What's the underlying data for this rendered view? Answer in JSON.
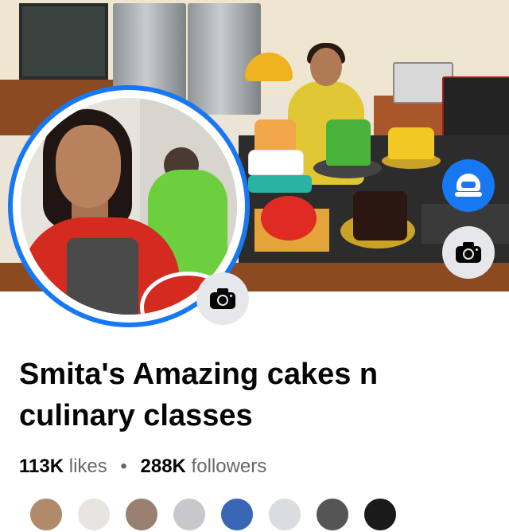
{
  "page": {
    "name": "Smita's Amazing cakes n culinary classes",
    "likes_count": "113K",
    "likes_label": "likes",
    "separator": "•",
    "followers_count": "288K",
    "followers_label": "followers"
  },
  "colors": {
    "accent": "#1877f2",
    "text_primary": "#050505",
    "text_secondary": "#65676b",
    "icon_button_bg": "#e6e7ea"
  },
  "icons": {
    "profile_photo_camera": "camera-icon",
    "cover_photo_camera": "camera-icon",
    "floating_button": "cap-icon"
  },
  "friend_avatars": [
    {
      "color": "#b08a6a"
    },
    {
      "color": "#e8e4e0"
    },
    {
      "color": "#9a8070"
    },
    {
      "color": "#c8c8cc"
    },
    {
      "color": "#3a66b8"
    },
    {
      "color": "#d9dde0"
    },
    {
      "color": "#555555"
    },
    {
      "color": "#1a1a1a"
    }
  ]
}
